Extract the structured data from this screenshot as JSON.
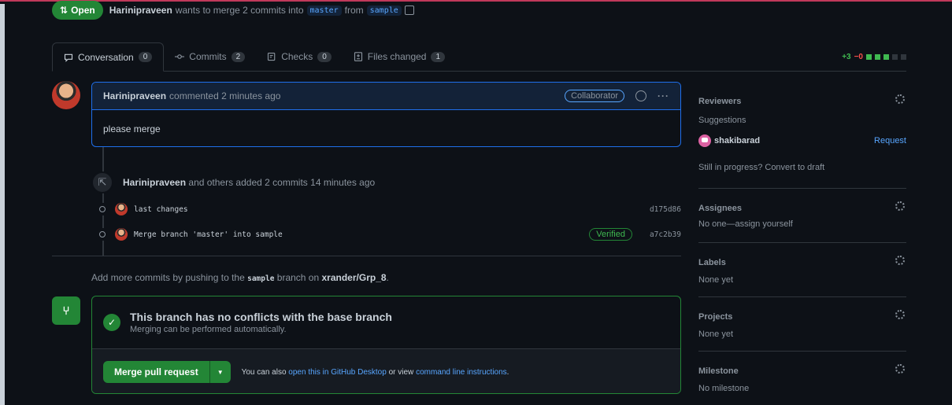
{
  "pr": {
    "state": "Open",
    "author": "Harinipraveen",
    "summary_text": "wants to merge 2 commits into",
    "base_branch": "master",
    "from_text": "from",
    "head_branch": "sample"
  },
  "tabs": [
    {
      "label": "Conversation",
      "count": "0"
    },
    {
      "label": "Commits",
      "count": "2"
    },
    {
      "label": "Checks",
      "count": "0"
    },
    {
      "label": "Files changed",
      "count": "1"
    }
  ],
  "diffstat": {
    "additions": "+3",
    "deletions": "−0"
  },
  "comment": {
    "author": "Harinipraveen",
    "meta": "commented 2 minutes ago",
    "role": "Collaborator",
    "body": "please merge"
  },
  "push_event": {
    "actor": "Harinipraveen",
    "text": "and others added 2 commits 14 minutes ago"
  },
  "commits": [
    {
      "message": "last changes",
      "sha": "d175d86",
      "verified": ""
    },
    {
      "message": "Merge branch 'master' into sample",
      "sha": "a7c2b39",
      "verified": "Verified"
    }
  ],
  "add_more": {
    "prefix": "Add more commits by pushing to the",
    "branch": "sample",
    "middle": "branch on",
    "repo": "xrander/Grp_8",
    "suffix": "."
  },
  "merge": {
    "title": "This branch has no conflicts with the base branch",
    "subtitle": "Merging can be performed automatically.",
    "button_label": "Merge pull request",
    "note_prefix": "You can also",
    "desktop_link": "open this in GitHub Desktop",
    "note_middle": "or view",
    "cli_link": "command line instructions",
    "note_suffix": "."
  },
  "sidebar": {
    "reviewers": {
      "title": "Reviewers",
      "suggestions": "Suggestions",
      "reviewer": "shakibarad",
      "request": "Request",
      "draft_note": "Still in progress? Convert to draft"
    },
    "assignees": {
      "title": "Assignees",
      "value": "No one—assign yourself"
    },
    "labels": {
      "title": "Labels",
      "value": "None yet"
    },
    "projects": {
      "title": "Projects",
      "value": "None yet"
    },
    "milestone": {
      "title": "Milestone",
      "value": "No milestone"
    }
  },
  "colors": {
    "accent_green": "#238636",
    "link_blue": "#58a6ff",
    "background": "#0d1117"
  }
}
